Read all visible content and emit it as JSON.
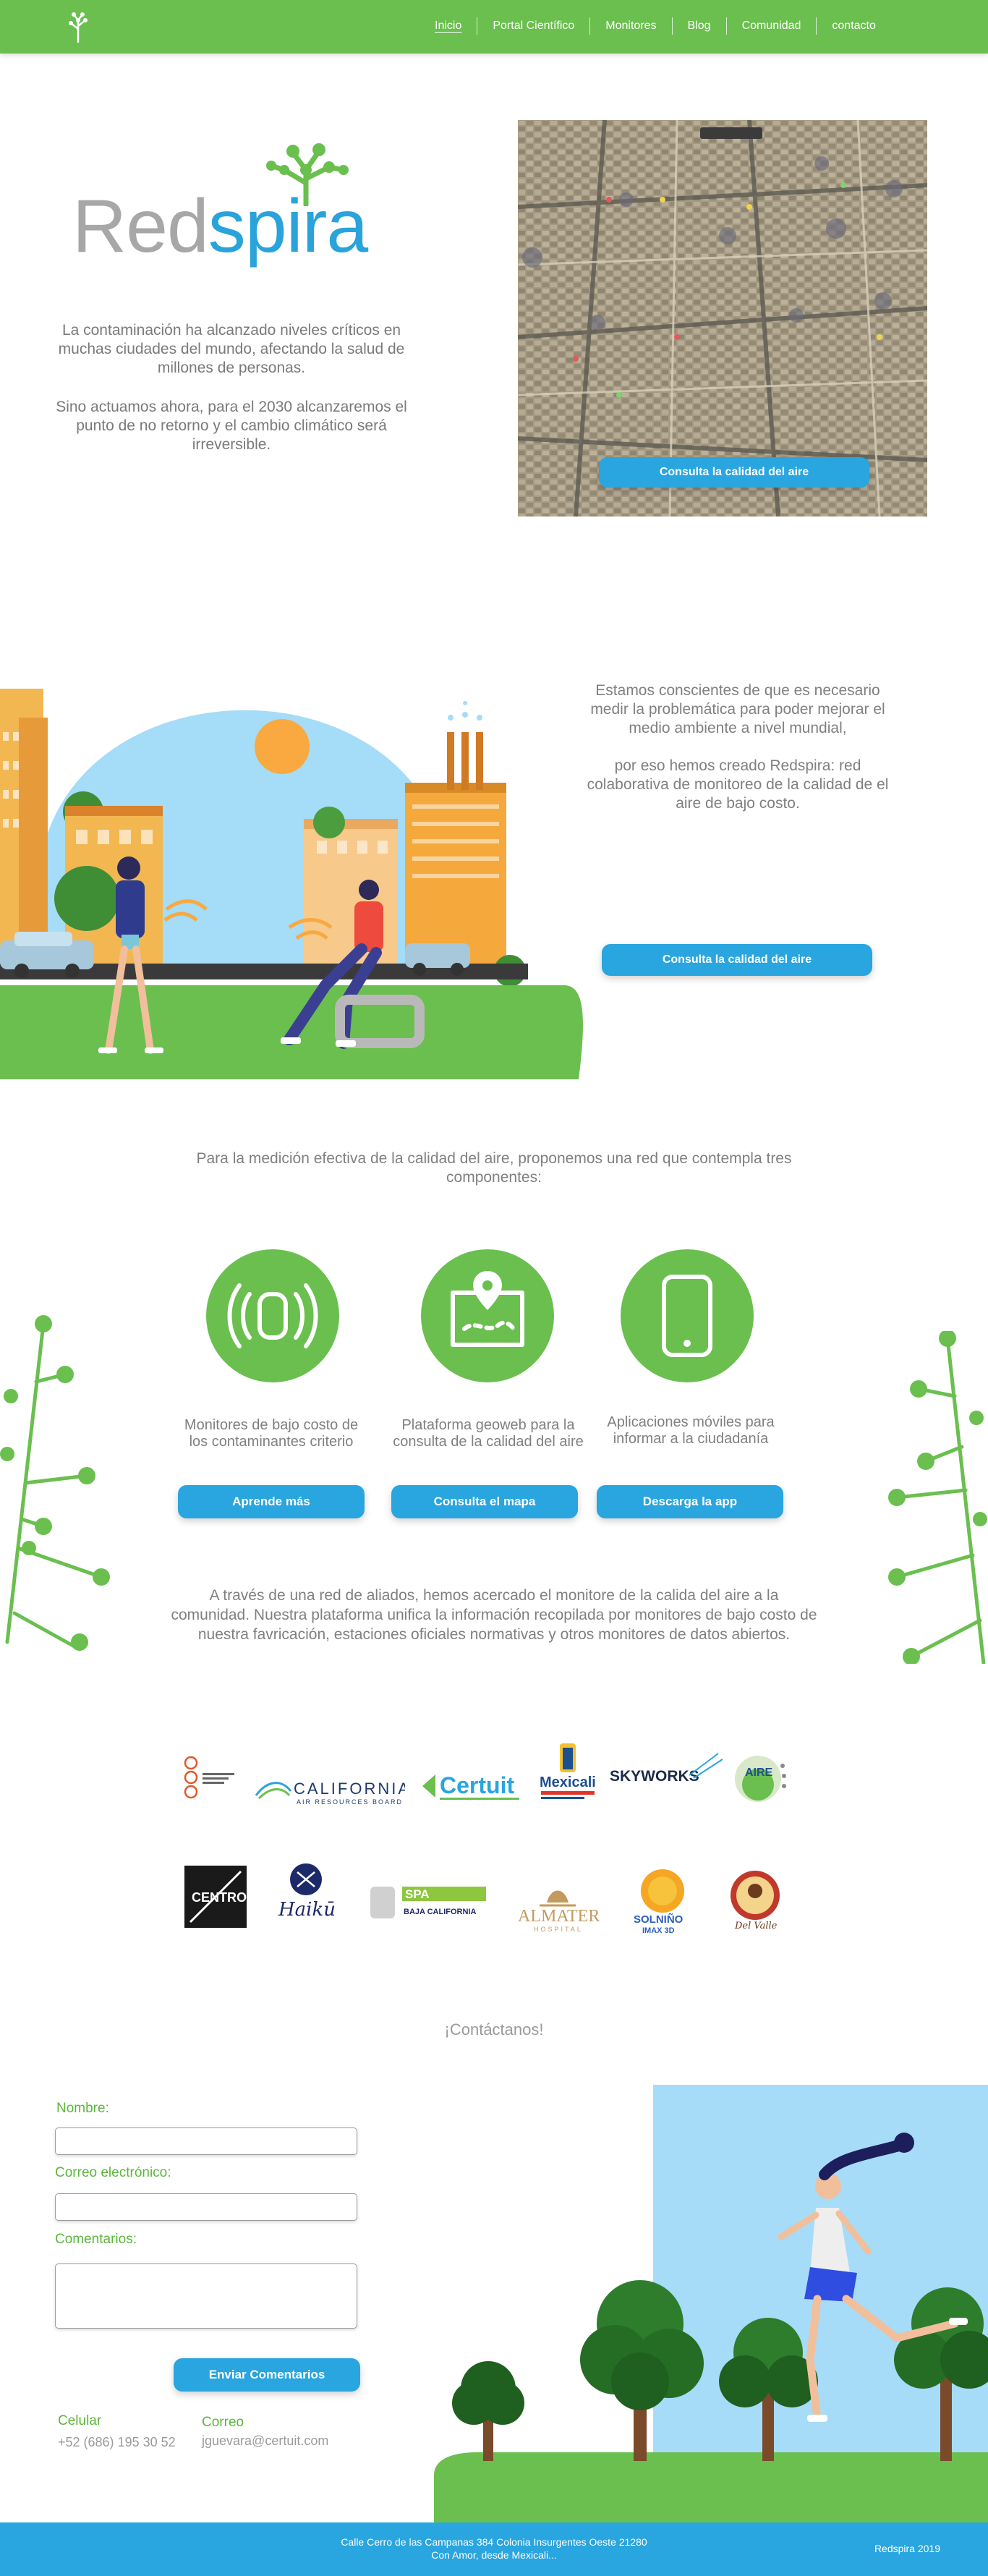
{
  "nav": {
    "logo_icon": "redspira-tree-icon",
    "links": [
      "Inicio",
      "Portal Científico",
      "Monitores",
      "Blog",
      "Comunidad",
      "contacto"
    ],
    "active": "Inicio"
  },
  "hero": {
    "logo_word_red": "Red",
    "logo_word_spira": "spira",
    "paragraph_1": "La contaminación ha  alcanzado niveles críticos en muchas ciudades del mundo, afectando la salud de millones de personas.",
    "paragraph_2": "Sino actuamos ahora, para el 2030 alcanzaremos el punto de no retorno y el cambio climático será irreversible.",
    "map_button": "Consulta la calidad del aire"
  },
  "section2": {
    "paragraph_1": "Estamos conscientes de que es necesario medir la problemática para poder mejorar el medio ambiente a nivel mundial,",
    "paragraph_2": "por eso hemos creado Redspira: red colaborativa de monitoreo de la calidad de el aire de bajo costo.",
    "button": "Consulta la calidad del aire"
  },
  "components": {
    "intro": "Para la medición efectiva de la calidad del aire, proponemos una red que contempla tres componentes:",
    "items": [
      {
        "icon": "sensor-icon",
        "label": "Monitores de bajo costo de los contaminantes criterio",
        "button": "Aprende más"
      },
      {
        "icon": "map-pin-icon",
        "label": "Plataforma geoweb para la consulta de la calidad del aire",
        "button": "Consulta el mapa"
      },
      {
        "icon": "smartphone-icon",
        "label": "Aplicaciones móviles para informar a la ciudadanía",
        "button": "Descarga la app"
      }
    ],
    "outro": "A través de una red de aliados, hemos acercado el monitore de la calida del aire a la comunidad. Nuestra plataforma unifica la información recopilada por monitores de bajo costo de nuestra favricación, estaciones oficiales normativas y otros monitores de datos abiertos."
  },
  "partners": {
    "row1": [
      "laboratorio-logo",
      "CALIFORNIA",
      "AIR RESOURCES BOARD",
      "Certuit",
      "Mexicali",
      "SKYWORKS",
      "AIRE"
    ],
    "row2": [
      "CENTRO",
      "Haikū",
      "SPA",
      "BAJA CALIFORNIA",
      "ALMATER",
      "HOSPITAL",
      "SOLNIÑO",
      "IMAX 3D",
      "Del Valle"
    ]
  },
  "contact": {
    "title": "¡Contáctanos!",
    "name_label": "Nombre:",
    "email_label": "Correo electrónico:",
    "comments_label": "Comentarios:",
    "name_value": "",
    "email_value": "",
    "comments_value": "",
    "submit": "Enviar Comentarios",
    "phone_label": "Celular",
    "phone_value": "+52 (686) 195 30 52",
    "mail_label": "Correo",
    "mail_value": "jguevara@certuit.com"
  },
  "footer": {
    "address_1": "Calle Cerro de las Campanas 384 Colonia Insurgentes Oeste 21280",
    "address_2": "Con Amor, desde Mexicali...",
    "copyright": "Redspira 2019"
  },
  "colors": {
    "green": "#6abf4f",
    "blue": "#29a5df",
    "text_gray": "#808080"
  }
}
